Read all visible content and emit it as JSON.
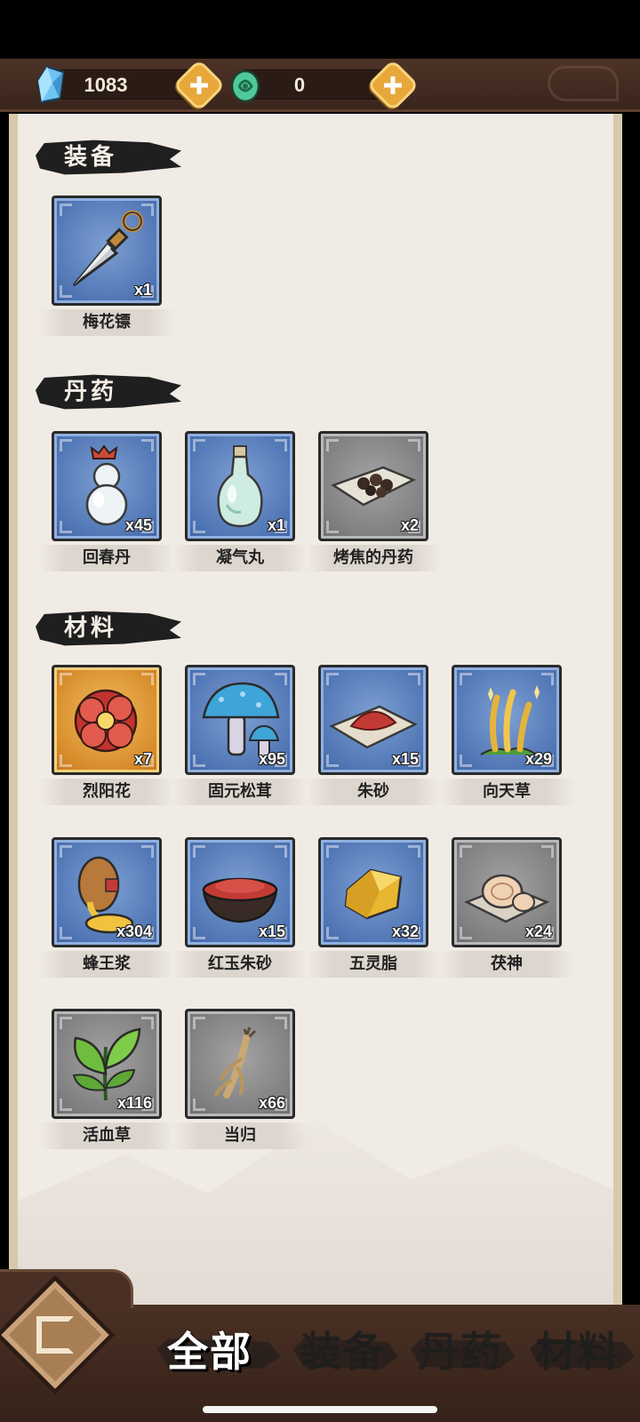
{
  "currencies": [
    {
      "icon": "blue-crystal-icon",
      "value": "1083"
    },
    {
      "icon": "jade-orb-icon",
      "value": "0"
    }
  ],
  "sections": {
    "equipment": {
      "title": "装备",
      "items": [
        {
          "name": "梅花镖",
          "count": "x1",
          "rarity": "blue",
          "icon": "throwing-dart-icon"
        }
      ]
    },
    "pills": {
      "title": "丹药",
      "items": [
        {
          "name": "回春丹",
          "count": "x45",
          "rarity": "blue",
          "icon": "gourd-bottle-icon"
        },
        {
          "name": "凝气丸",
          "count": "x1",
          "rarity": "blue",
          "icon": "vase-bottle-icon"
        },
        {
          "name": "烤焦的丹药",
          "count": "x2",
          "rarity": "gray",
          "icon": "burnt-pills-icon"
        }
      ]
    },
    "materials": {
      "title": "材料",
      "items": [
        {
          "name": "烈阳花",
          "count": "x7",
          "rarity": "gold",
          "icon": "red-flower-icon"
        },
        {
          "name": "固元松茸",
          "count": "x95",
          "rarity": "blue",
          "icon": "mushroom-icon"
        },
        {
          "name": "朱砂",
          "count": "x15",
          "rarity": "blue",
          "icon": "cinnabar-powder-icon"
        },
        {
          "name": "向天草",
          "count": "x29",
          "rarity": "blue",
          "icon": "golden-grass-icon"
        },
        {
          "name": "蜂王浆",
          "count": "x304",
          "rarity": "blue",
          "icon": "royal-jelly-icon"
        },
        {
          "name": "红玉朱砂",
          "count": "x15",
          "rarity": "blue",
          "icon": "cinnabar-bowl-icon"
        },
        {
          "name": "五灵脂",
          "count": "x32",
          "rarity": "blue",
          "icon": "gold-resin-icon"
        },
        {
          "name": "茯神",
          "count": "x24",
          "rarity": "gray",
          "icon": "poria-fungus-icon"
        },
        {
          "name": "活血草",
          "count": "x116",
          "rarity": "gray",
          "icon": "green-herb-icon"
        },
        {
          "name": "当归",
          "count": "x66",
          "rarity": "gray",
          "icon": "angelica-root-icon"
        }
      ]
    }
  },
  "tabs": [
    {
      "label": "全部",
      "active": true
    },
    {
      "label": "装备",
      "active": false
    },
    {
      "label": "丹药",
      "active": false
    },
    {
      "label": "材料",
      "active": false
    }
  ],
  "colors": {
    "frame_brown": "#4a3024",
    "panel_bg": "#f0ebe4",
    "slot_blue": "#4f75b4",
    "slot_gray": "#7e7e7e",
    "slot_gold": "#d78a2a",
    "plus_gold": "#e8a73a"
  }
}
